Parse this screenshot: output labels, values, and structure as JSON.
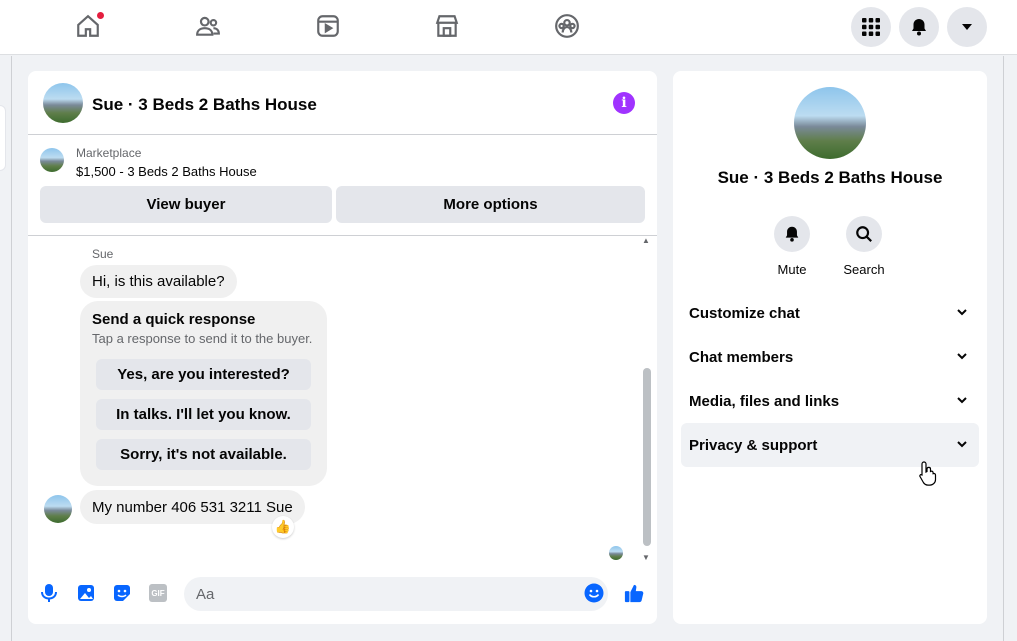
{
  "topbar": {
    "nav": [
      {
        "name": "home-icon"
      },
      {
        "name": "friends-icon"
      },
      {
        "name": "watch-icon"
      },
      {
        "name": "marketplace-icon"
      },
      {
        "name": "groups-icon"
      }
    ],
    "right_buttons": [
      {
        "name": "menu-grid-icon"
      },
      {
        "name": "notifications-bell-icon"
      },
      {
        "name": "account-dropdown-icon"
      }
    ],
    "colors": {
      "notification_dot": "#e41e3f",
      "accent": "#0866ff"
    }
  },
  "chat": {
    "title": "Sue · 3 Beds 2 Baths House",
    "marketplace": {
      "label": "Marketplace",
      "listing": "$1,500 - 3 Beds 2 Baths House"
    },
    "buttons": {
      "view_buyer": "View buyer",
      "more_options": "More options"
    },
    "messages": {
      "sender_name": "Sue",
      "first": "Hi, is this available?",
      "quick_response": {
        "title": "Send a quick response",
        "subtitle": "Tap a response to send it to the buyer.",
        "options": [
          "Yes, are you interested?",
          "In talks. I'll let you know.",
          "Sorry, it's not available."
        ]
      },
      "second": "My number 406 531 3211 Sue",
      "reaction": "👍"
    },
    "composer": {
      "placeholder": "Aa",
      "icons": [
        "microphone-icon",
        "photo-icon",
        "sticker-icon",
        "gif-icon",
        "emoji-icon",
        "like-thumb-icon"
      ],
      "gif_text": "GIF"
    }
  },
  "info_panel": {
    "title": "Sue · 3 Beds 2 Baths House",
    "actions": [
      {
        "label": "Mute",
        "icon": "bell-icon"
      },
      {
        "label": "Search",
        "icon": "search-icon"
      }
    ],
    "sections": [
      "Customize chat",
      "Chat members",
      "Media, files and links",
      "Privacy & support"
    ]
  }
}
